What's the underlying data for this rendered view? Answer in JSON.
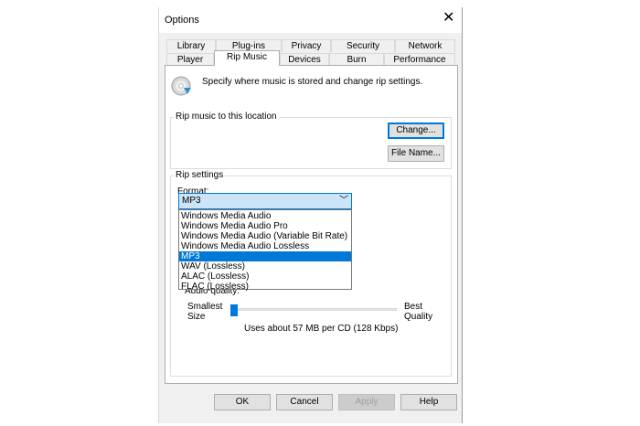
{
  "window": {
    "title": "Options"
  },
  "tabs_row1": [
    "Library",
    "Plug-ins",
    "Privacy",
    "Security",
    "Network"
  ],
  "tabs_row2": [
    "Player",
    "Rip Music",
    "Devices",
    "Burn",
    "Performance"
  ],
  "active_tab": "Rip Music",
  "description": "Specify where music is stored and change rip settings.",
  "location_group": {
    "label": "Rip music to this location",
    "change_button": "Change...",
    "filename_button": "File Name..."
  },
  "rip_settings": {
    "label": "Rip settings",
    "format_label": "Format:",
    "selected_format": "MP3",
    "format_options": [
      "Windows Media Audio",
      "Windows Media Audio Pro",
      "Windows Media Audio (Variable Bit Rate)",
      "Windows Media Audio Lossless",
      "MP3",
      "WAV (Lossless)",
      "ALAC (Lossless)",
      "FLAC (Lossless)"
    ],
    "audio_quality_label": "Audio quality:",
    "smallest_label_1": "Smallest",
    "smallest_label_2": "Size",
    "best_label_1": "Best",
    "best_label_2": "Quality",
    "usage_text": "Uses about 57 MB per CD (128 Kbps)"
  },
  "footer": {
    "ok": "OK",
    "cancel": "Cancel",
    "apply": "Apply",
    "help": "Help"
  },
  "colors": {
    "accent": "#0078d7",
    "dialog_bg": "#f0f0f0",
    "selection_bg": "#cce4f7"
  }
}
